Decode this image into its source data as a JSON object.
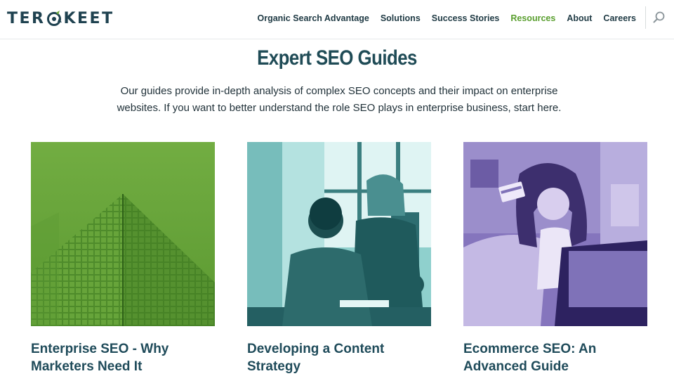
{
  "brand": {
    "logo_before": "TER",
    "logo_after": "KEET"
  },
  "nav": {
    "items": [
      {
        "label": "Organic Search Advantage",
        "active": false
      },
      {
        "label": "Solutions",
        "active": false
      },
      {
        "label": "Success Stories",
        "active": false
      },
      {
        "label": "Resources",
        "active": true
      },
      {
        "label": "About",
        "active": false
      },
      {
        "label": "Careers",
        "active": false
      }
    ],
    "search_icon": "search-icon"
  },
  "main": {
    "title": "Expert SEO Guides",
    "intro": "Our guides provide in-depth analysis of complex SEO concepts and their impact on enterprise websites. If you want to better understand the role SEO plays in enterprise business, start here.",
    "guides": [
      {
        "title": "Enterprise SEO - Why Marketers Need It",
        "image": "building-photo",
        "tint": "#5e9a34"
      },
      {
        "title": "Developing a Content Strategy",
        "image": "office-team-photo",
        "tint": "#3f8f8e"
      },
      {
        "title": "Ecommerce SEO: An Advanced Guide",
        "image": "shopper-photo",
        "tint": "#7a6ab5"
      }
    ]
  },
  "colors": {
    "accent": "#5a9f2f",
    "brand_text": "#1f4250"
  }
}
